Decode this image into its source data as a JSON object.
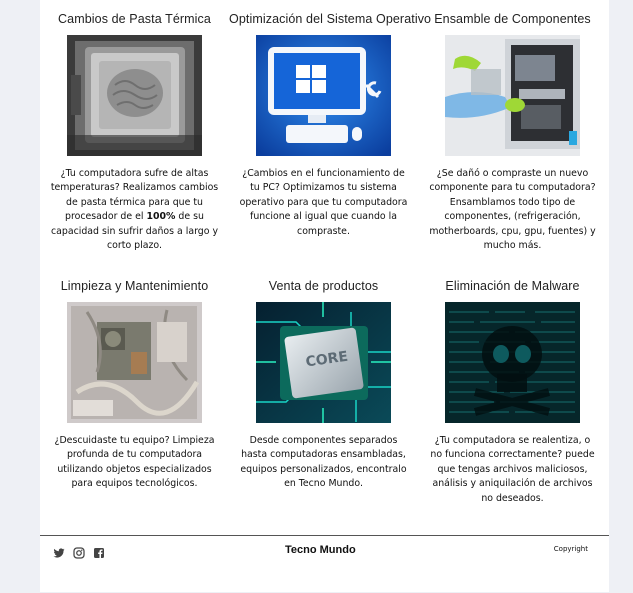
{
  "services": [
    {
      "title": "Cambios de Pasta Térmica",
      "image_icon": "cpu-thermal-paste-photo",
      "desc_pre": "¿Tu computadora sufre de altas temperaturas? Realizamos cambios de pasta térmica para que tu procesador de el ",
      "desc_bold": "100%",
      "desc_post": " de su capacidad sin sufrir daños a largo y corto plazo."
    },
    {
      "title": "Optimización del Sistema Operativo",
      "image_icon": "windows-os-tools-illustration",
      "desc_pre": "¿Cambios en el funcionamiento de tu PC? Optimizamos tu sistema operativo para que tu computadora funcione al igual que cuando la compraste.",
      "desc_bold": "",
      "desc_post": ""
    },
    {
      "title": "Ensamble de Componentes",
      "image_icon": "pc-assembly-photo",
      "desc_pre": "¿Se dañó o compraste un nuevo componente para tu computadora? Ensamblamos todo tipo de componentes, (refrigeración, motherboards, cpu, gpu, fuentes) y mucho más.",
      "desc_bold": "",
      "desc_post": ""
    },
    {
      "title": "Limpieza y Mantenimiento",
      "image_icon": "dusty-pc-interior-photo",
      "desc_pre": "¿Descuidaste tu equipo? Limpieza profunda de tu computadora utilizando objetos especializados para equipos tecnológicos.",
      "desc_bold": "",
      "desc_post": ""
    },
    {
      "title": "Venta de productos",
      "image_icon": "intel-core-chip-photo",
      "desc_pre": "Desde componentes separados hasta computadoras ensambladas, equipos personalizados, encontralo en Tecno Mundo.",
      "desc_bold": "",
      "desc_post": ""
    },
    {
      "title": "Eliminación de Malware",
      "image_icon": "malware-skull-photo",
      "desc_pre": "¿Tu computadora se realentiza, o no funciona correctamente? puede que tengas archivos maliciosos, análisis y aniquilación de archivos no deseados.",
      "desc_bold": "",
      "desc_post": ""
    }
  ],
  "footer": {
    "social": [
      "twitter-icon",
      "instagram-icon",
      "facebook-icon"
    ],
    "brand": "Tecno Mundo",
    "copyright": "Copyright"
  }
}
